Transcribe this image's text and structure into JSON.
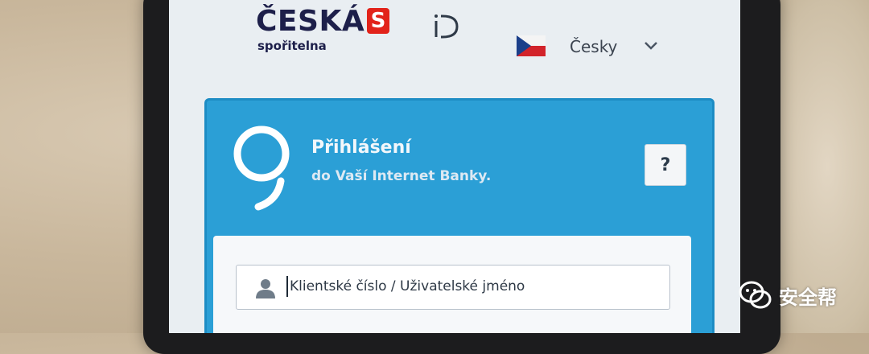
{
  "header": {
    "logo_title": "ČESKÁ",
    "logo_symbol": "S",
    "logo_subtitle": "spořitelna",
    "id_icon": "id-icon",
    "language": {
      "flag": "czech-flag-icon",
      "label": "Česky",
      "dropdown_icon": "chevron-down-icon"
    }
  },
  "login_panel": {
    "logo_icon": "george-logo-icon",
    "title": "Přihlášení",
    "subtitle": "do Vaší Internet Banky.",
    "help_label": "?",
    "username_field": {
      "icon": "user-icon",
      "placeholder": "Klientské číslo / Uživatelské jméno"
    }
  },
  "watermark": {
    "icon": "wechat-icon",
    "text": "安全帮"
  },
  "colors": {
    "panel_blue": "#2b9fd6",
    "brand_red": "#e2231a",
    "brand_navy": "#1d1f4a"
  }
}
